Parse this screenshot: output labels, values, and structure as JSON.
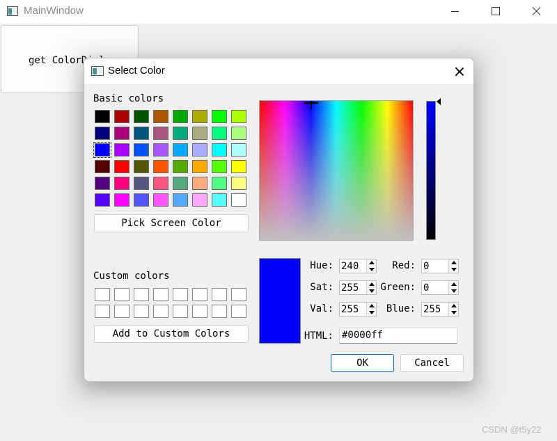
{
  "main_window": {
    "title": "MainWindow",
    "button_label": "get ColorDial",
    "watermark": "CSDN @t5y22"
  },
  "dialog": {
    "title": "Select Color",
    "basic_colors_label": "Basic colors",
    "custom_colors_label": "Custom colors",
    "pick_screen_color_label": "Pick Screen Color",
    "add_custom_colors_label": "Add to Custom Colors",
    "ok_label": "OK",
    "cancel_label": "Cancel",
    "basic_colors": [
      "#000000",
      "#aa0000",
      "#005500",
      "#aa5500",
      "#00aa00",
      "#aaaa00",
      "#00ff00",
      "#aaff00",
      "#00007f",
      "#aa007f",
      "#00557f",
      "#aa557f",
      "#00aa7f",
      "#aaaa7f",
      "#00ff7f",
      "#aaff7f",
      "#0000ff",
      "#aa00ff",
      "#0055ff",
      "#aa55ff",
      "#00aaff",
      "#aaaaff",
      "#00ffff",
      "#aaffff",
      "#550000",
      "#ff0000",
      "#555500",
      "#ff5500",
      "#55aa00",
      "#ffaa00",
      "#55ff00",
      "#ffff00",
      "#55007f",
      "#ff007f",
      "#55557f",
      "#ff557f",
      "#55aa7f",
      "#ffaa7f",
      "#55ff7f",
      "#ffff7f",
      "#5500ff",
      "#ff00ff",
      "#5555ff",
      "#ff55ff",
      "#55aaff",
      "#ffaaff",
      "#55ffff",
      "#ffffff"
    ],
    "selected_basic_index": 16,
    "custom_colors": [
      "#ffffff",
      "#ffffff",
      "#ffffff",
      "#ffffff",
      "#ffffff",
      "#ffffff",
      "#ffffff",
      "#ffffff",
      "#ffffff",
      "#ffffff",
      "#ffffff",
      "#ffffff",
      "#ffffff",
      "#ffffff",
      "#ffffff",
      "#ffffff"
    ],
    "current_color": "#0000ff",
    "fields": {
      "hue_label": "Hue:",
      "hue": "240",
      "sat_label": "Sat:",
      "sat": "255",
      "val_label": "Val:",
      "val": "255",
      "red_label": "Red:",
      "red": "0",
      "green_label": "Green:",
      "green": "0",
      "blue_label": "Blue:",
      "blue": "255",
      "html_label": "HTML:",
      "html": "#0000ff"
    }
  }
}
